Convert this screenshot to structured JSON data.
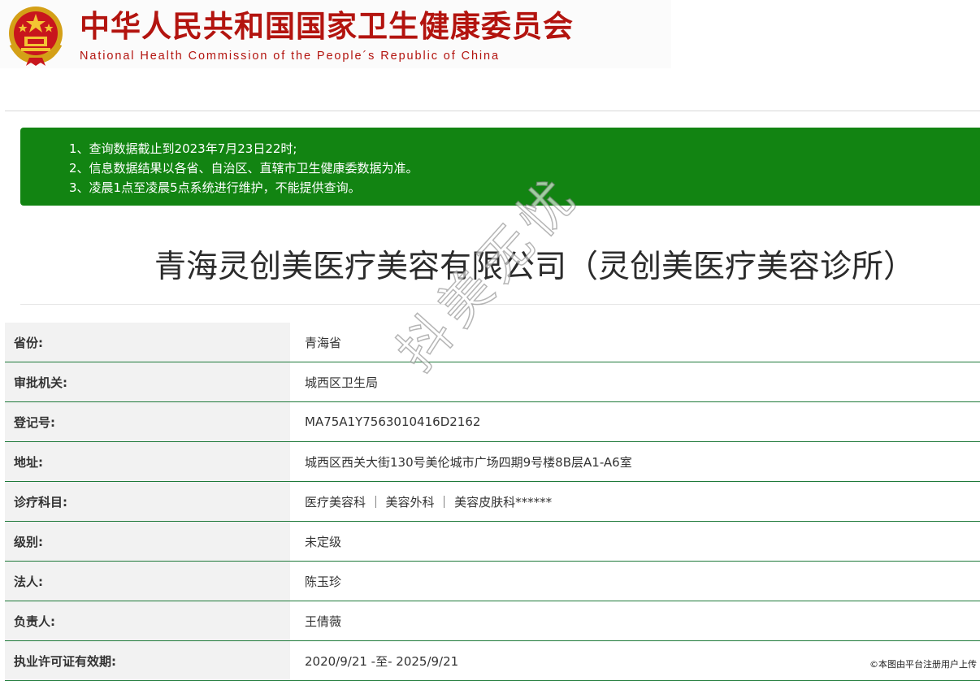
{
  "header": {
    "title_cn": "中华人民共和国国家卫生健康委员会",
    "title_en": "National Health Commission of the People´s Republic of China",
    "emblem_icon": "national-emblem-icon",
    "brand_color": "#b3140f"
  },
  "notice": {
    "bg_color": "#128412",
    "items": [
      "1、查询数据截止到2023年7月23日22时;",
      "2、信息数据结果以各省、自治区、直辖市卫生健康委数据为准。",
      "3、凌晨1点至凌晨5点系统进行维护，不能提供查询。"
    ]
  },
  "company": {
    "title": "青海灵创美医疗美容有限公司（灵创美医疗美容诊所）"
  },
  "info": {
    "rows": [
      {
        "label": "省份:",
        "value": "青海省"
      },
      {
        "label": "审批机关:",
        "value": "城西区卫生局"
      },
      {
        "label": "登记号:",
        "value": "MA75A1Y7563010416D2162"
      },
      {
        "label": "地址:",
        "value": "城西区西关大街130号美伦城市广场四期9号楼8B层A1-A6室"
      },
      {
        "label": "诊疗科目:",
        "value": "医疗美容科 ｜ 美容外科 ｜ 美容皮肤科******"
      },
      {
        "label": "级别:",
        "value": "未定级"
      },
      {
        "label": "法人:",
        "value": "陈玉珍"
      },
      {
        "label": "负责人:",
        "value": "王倩薇"
      },
      {
        "label": "执业许可证有效期:",
        "value": "2020/9/21 -至- 2025/9/21"
      }
    ]
  },
  "watermark": {
    "text": "抖美无忧"
  },
  "upload_note": "©本图由平台注册用户上传"
}
